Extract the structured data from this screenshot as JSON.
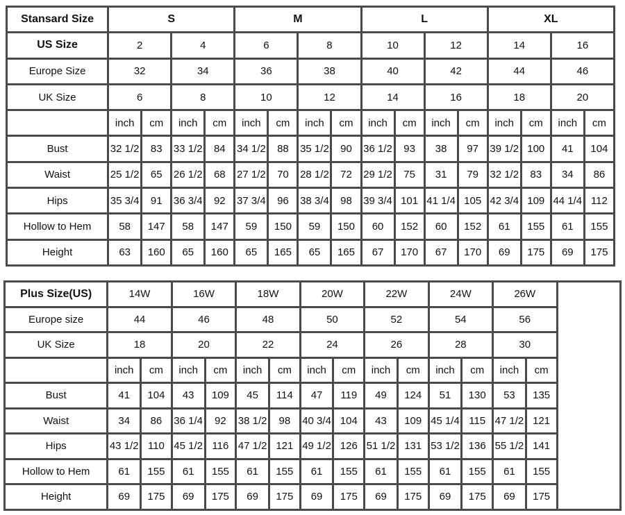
{
  "standard": {
    "header_label": "Stansard Size",
    "groups": [
      "S",
      "M",
      "L",
      "XL"
    ],
    "rows": [
      {
        "label": "US Size",
        "bold": true,
        "values": [
          "2",
          "4",
          "6",
          "8",
          "10",
          "12",
          "14",
          "16"
        ]
      },
      {
        "label": "Europe Size",
        "values": [
          "32",
          "34",
          "36",
          "38",
          "40",
          "42",
          "44",
          "46"
        ]
      },
      {
        "label": "UK Size",
        "values": [
          "6",
          "8",
          "10",
          "12",
          "14",
          "16",
          "18",
          "20"
        ]
      }
    ],
    "unit_row": [
      "inch",
      "cm",
      "inch",
      "cm",
      "inch",
      "cm",
      "inch",
      "cm",
      "inch",
      "cm",
      "inch",
      "cm",
      "inch",
      "cm",
      "inch",
      "cm"
    ],
    "measurements": [
      {
        "label": "Bust",
        "values": [
          "32 1/2",
          "83",
          "33 1/2",
          "84",
          "34 1/2",
          "88",
          "35 1/2",
          "90",
          "36 1/2",
          "93",
          "38",
          "97",
          "39 1/2",
          "100",
          "41",
          "104"
        ]
      },
      {
        "label": "Waist",
        "values": [
          "25 1/2",
          "65",
          "26 1/2",
          "68",
          "27 1/2",
          "70",
          "28 1/2",
          "72",
          "29 1/2",
          "75",
          "31",
          "79",
          "32 1/2",
          "83",
          "34",
          "86"
        ]
      },
      {
        "label": "Hips",
        "values": [
          "35 3/4",
          "91",
          "36 3/4",
          "92",
          "37 3/4",
          "96",
          "38 3/4",
          "98",
          "39 3/4",
          "101",
          "41 1/4",
          "105",
          "42 3/4",
          "109",
          "44 1/4",
          "112"
        ]
      },
      {
        "label": "Hollow to Hem",
        "values": [
          "58",
          "147",
          "58",
          "147",
          "59",
          "150",
          "59",
          "150",
          "60",
          "152",
          "60",
          "152",
          "61",
          "155",
          "61",
          "155"
        ]
      },
      {
        "label": "Height",
        "values": [
          "63",
          "160",
          "65",
          "160",
          "65",
          "165",
          "65",
          "165",
          "67",
          "170",
          "67",
          "170",
          "69",
          "175",
          "69",
          "175"
        ]
      }
    ]
  },
  "plus": {
    "header_label": "Plus Size(US)",
    "sizes": [
      "14W",
      "16W",
      "18W",
      "20W",
      "22W",
      "24W",
      "26W"
    ],
    "rows": [
      {
        "label": "Europe size",
        "values": [
          "44",
          "46",
          "48",
          "50",
          "52",
          "54",
          "56"
        ]
      },
      {
        "label": "UK Size",
        "values": [
          "18",
          "20",
          "22",
          "24",
          "26",
          "28",
          "30"
        ]
      }
    ],
    "unit_row": [
      "inch",
      "cm",
      "inch",
      "cm",
      "inch",
      "cm",
      "inch",
      "cm",
      "inch",
      "cm",
      "inch",
      "cm",
      "inch",
      "cm"
    ],
    "measurements": [
      {
        "label": "Bust",
        "values": [
          "41",
          "104",
          "43",
          "109",
          "45",
          "114",
          "47",
          "119",
          "49",
          "124",
          "51",
          "130",
          "53",
          "135"
        ]
      },
      {
        "label": "Waist",
        "values": [
          "34",
          "86",
          "36 1/4",
          "92",
          "38 1/2",
          "98",
          "40 3/4",
          "104",
          "43",
          "109",
          "45 1/4",
          "115",
          "47 1/2",
          "121"
        ]
      },
      {
        "label": "Hips",
        "values": [
          "43 1/2",
          "110",
          "45 1/2",
          "116",
          "47 1/2",
          "121",
          "49 1/2",
          "126",
          "51 1/2",
          "131",
          "53 1/2",
          "136",
          "55 1/2",
          "141"
        ]
      },
      {
        "label": "Hollow to Hem",
        "values": [
          "61",
          "155",
          "61",
          "155",
          "61",
          "155",
          "61",
          "155",
          "61",
          "155",
          "61",
          "155",
          "61",
          "155"
        ]
      },
      {
        "label": "Height",
        "values": [
          "69",
          "175",
          "69",
          "175",
          "69",
          "175",
          "69",
          "175",
          "69",
          "175",
          "69",
          "175",
          "69",
          "175"
        ]
      }
    ]
  }
}
